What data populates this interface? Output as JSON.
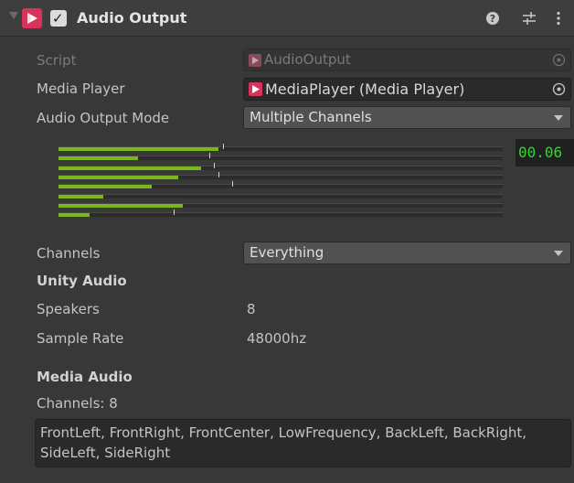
{
  "header": {
    "title": "Audio Output",
    "enabled": true,
    "icons": [
      "help-icon",
      "preset-icon",
      "more-icon"
    ]
  },
  "fields": {
    "script": {
      "label": "Script",
      "value": "AudioOutput"
    },
    "media_player": {
      "label": "Media Player",
      "value": "MediaPlayer (Media Player)"
    },
    "audio_output_mode": {
      "label": "Audio Output Mode",
      "value": "Multiple Channels"
    },
    "channels": {
      "label": "Channels",
      "value": "Everything"
    }
  },
  "meter": {
    "readout": "00.06",
    "levels": [
      0.36,
      0.18,
      0.32,
      0.27,
      0.21,
      0.1,
      0.28,
      0.07
    ],
    "peaks": [
      0.37,
      0.34,
      0.35,
      0.36,
      0.39,
      null,
      null,
      0.26
    ],
    "colors": {
      "fill": "#79b71b",
      "readout": "#2bd92b"
    }
  },
  "unity_audio": {
    "heading": "Unity Audio",
    "speakers_label": "Speakers",
    "speakers_value": "8",
    "sample_rate_label": "Sample Rate",
    "sample_rate_value": "48000hz"
  },
  "media_audio": {
    "heading": "Media Audio",
    "channels_text": "Channels: 8",
    "channel_list": "FrontLeft, FrontRight, FrontCenter, LowFrequency, BackLeft, BackRight, SideLeft, SideRight"
  }
}
